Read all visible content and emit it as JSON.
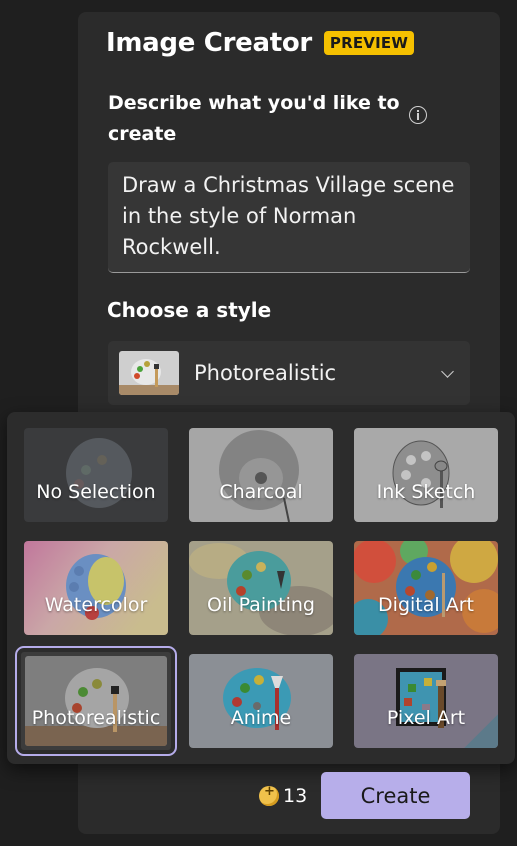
{
  "header": {
    "title": "Image Creator",
    "badge": "PREVIEW"
  },
  "prompt": {
    "label": "Describe what you'd like to create",
    "value": "Draw a Christmas Village scene in the style of Norman Rockwell.",
    "info_icon": "info-icon"
  },
  "style": {
    "label": "Choose a style",
    "selected": "Photorealistic",
    "options": [
      {
        "label": "No Selection",
        "thumbnail": "faded-palette"
      },
      {
        "label": "Charcoal",
        "thumbnail": "charcoal-sketch"
      },
      {
        "label": "Ink Sketch",
        "thumbnail": "ink-palette"
      },
      {
        "label": "Watercolor",
        "thumbnail": "watercolor-palette"
      },
      {
        "label": "Oil Painting",
        "thumbnail": "oil-palette"
      },
      {
        "label": "Digital Art",
        "thumbnail": "digital-palette"
      },
      {
        "label": "Photorealistic",
        "thumbnail": "photo-palette",
        "selected": true
      },
      {
        "label": "Anime",
        "thumbnail": "anime-palette"
      },
      {
        "label": "Pixel Art",
        "thumbnail": "pixel-palette"
      }
    ]
  },
  "footer": {
    "credits": "13",
    "credit_icon": "coin-icon",
    "create_label": "Create"
  },
  "colors": {
    "accent": "#b7aeea",
    "badge": "#f5c000",
    "panel": "#2b2b2b",
    "background": "#1f1f1f"
  }
}
